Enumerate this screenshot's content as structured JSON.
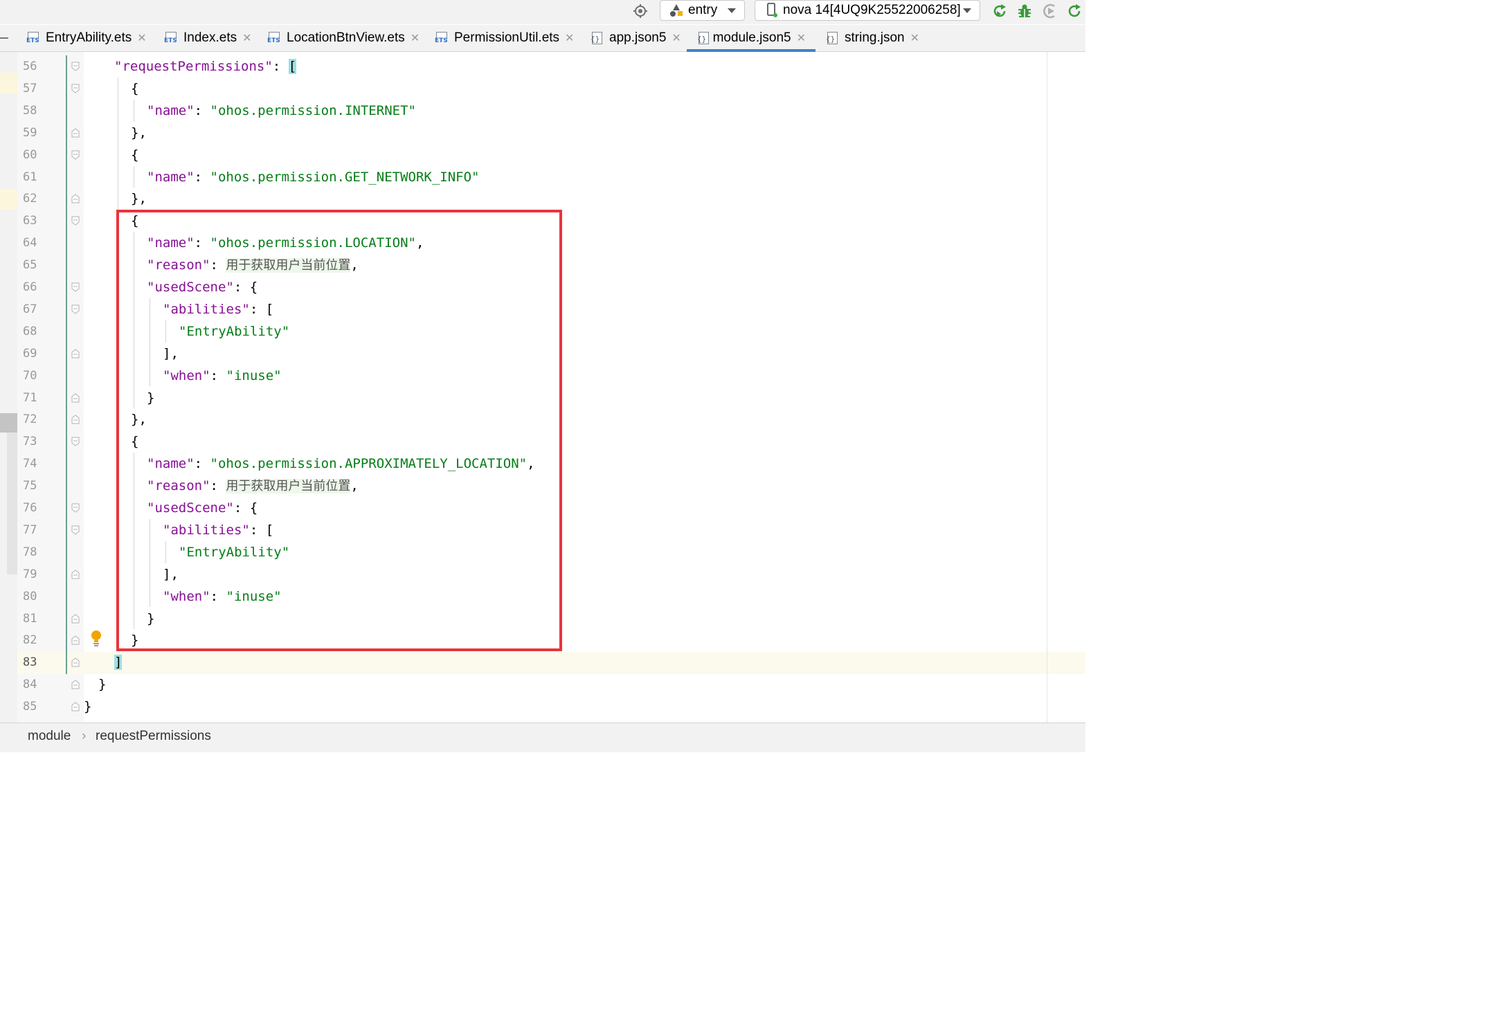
{
  "toolbar": {
    "config_name": "entry",
    "device_name": "nova 14[4UQ9K25522006258]",
    "icons": [
      "target-icon",
      "entry-config-icon",
      "device-icon",
      "rerun-icon",
      "debug-icon",
      "profiler-icon",
      "refresh-icon"
    ]
  },
  "tabs": [
    {
      "label": "EntryAbility.ets",
      "type": "ets"
    },
    {
      "label": "Index.ets",
      "type": "ets"
    },
    {
      "label": "LocationBtnView.ets",
      "type": "ets"
    },
    {
      "label": "PermissionUtil.ets",
      "type": "ets"
    },
    {
      "label": "app.json5",
      "type": "json"
    },
    {
      "label": "module.json5",
      "type": "json",
      "active": true
    },
    {
      "label": "string.json",
      "type": "json"
    }
  ],
  "editor": {
    "lines": [
      {
        "n": "56",
        "segs": [
          [
            "k",
            "\"requestPermissions\""
          ],
          [
            "p",
            ": "
          ],
          [
            "bh",
            "["
          ]
        ]
      },
      {
        "n": "57",
        "segs": [
          [
            "p",
            "{"
          ]
        ]
      },
      {
        "n": "58",
        "segs": [
          [
            "k",
            "\"name\""
          ],
          [
            "p",
            ": "
          ],
          [
            "s",
            "\"ohos.permission.INTERNET\""
          ]
        ]
      },
      {
        "n": "59",
        "segs": [
          [
            "p",
            "},"
          ]
        ]
      },
      {
        "n": "60",
        "segs": [
          [
            "p",
            "{"
          ]
        ]
      },
      {
        "n": "61",
        "segs": [
          [
            "k",
            "\"name\""
          ],
          [
            "p",
            ": "
          ],
          [
            "s",
            "\"ohos.permission.GET_NETWORK_INFO\""
          ]
        ]
      },
      {
        "n": "62",
        "segs": [
          [
            "p",
            "},"
          ]
        ]
      },
      {
        "n": "63",
        "segs": [
          [
            "p",
            "{"
          ]
        ]
      },
      {
        "n": "64",
        "segs": [
          [
            "k",
            "\"name\""
          ],
          [
            "p",
            ": "
          ],
          [
            "s",
            "\"ohos.permission.LOCATION\""
          ],
          [
            "p",
            ","
          ]
        ]
      },
      {
        "n": "65",
        "segs": [
          [
            "k",
            "\"reason\""
          ],
          [
            "p",
            ": "
          ],
          [
            "zh",
            "用于获取用户当前位置"
          ],
          [
            "p",
            ","
          ]
        ]
      },
      {
        "n": "66",
        "segs": [
          [
            "k",
            "\"usedScene\""
          ],
          [
            "p",
            ": {"
          ]
        ]
      },
      {
        "n": "67",
        "segs": [
          [
            "k",
            "\"abilities\""
          ],
          [
            "p",
            ": ["
          ]
        ]
      },
      {
        "n": "68",
        "segs": [
          [
            "s",
            "\"EntryAbility\""
          ]
        ]
      },
      {
        "n": "69",
        "segs": [
          [
            "p",
            "],"
          ]
        ]
      },
      {
        "n": "70",
        "segs": [
          [
            "k",
            "\"when\""
          ],
          [
            "p",
            ": "
          ],
          [
            "s",
            "\"inuse\""
          ]
        ]
      },
      {
        "n": "71",
        "segs": [
          [
            "p",
            "}"
          ]
        ]
      },
      {
        "n": "72",
        "segs": [
          [
            "p",
            "},"
          ]
        ]
      },
      {
        "n": "73",
        "segs": [
          [
            "p",
            "{"
          ]
        ]
      },
      {
        "n": "74",
        "segs": [
          [
            "k",
            "\"name\""
          ],
          [
            "p",
            ": "
          ],
          [
            "s",
            "\"ohos.permission.APPROXIMATELY_LOCATION\""
          ],
          [
            "p",
            ","
          ]
        ]
      },
      {
        "n": "75",
        "segs": [
          [
            "k",
            "\"reason\""
          ],
          [
            "p",
            ": "
          ],
          [
            "zh",
            "用于获取用户当前位置"
          ],
          [
            "p",
            ","
          ]
        ]
      },
      {
        "n": "76",
        "segs": [
          [
            "k",
            "\"usedScene\""
          ],
          [
            "p",
            ": {"
          ]
        ]
      },
      {
        "n": "77",
        "segs": [
          [
            "k",
            "\"abilities\""
          ],
          [
            "p",
            ": ["
          ]
        ]
      },
      {
        "n": "78",
        "segs": [
          [
            "s",
            "\"EntryAbility\""
          ]
        ]
      },
      {
        "n": "79",
        "segs": [
          [
            "p",
            "],"
          ]
        ]
      },
      {
        "n": "80",
        "segs": [
          [
            "k",
            "\"when\""
          ],
          [
            "p",
            ": "
          ],
          [
            "s",
            "\"inuse\""
          ]
        ]
      },
      {
        "n": "81",
        "segs": [
          [
            "p",
            "}"
          ]
        ]
      },
      {
        "n": "82",
        "segs": [
          [
            "p",
            "}"
          ]
        ]
      },
      {
        "n": "83",
        "segs": [
          [
            "bh",
            "]"
          ]
        ]
      },
      {
        "n": "84",
        "segs": [
          [
            "p",
            "}"
          ]
        ]
      },
      {
        "n": "85",
        "segs": [
          [
            "p",
            "}"
          ]
        ]
      }
    ]
  },
  "breadcrumb": {
    "items": [
      "module",
      "requestPermissions"
    ],
    "separator": "›"
  },
  "colors": {
    "key": "#871094",
    "string": "#067d17",
    "highlight_box": "#e8343c",
    "current_line": "#fcfaed",
    "tab_underline": "#4083c9"
  }
}
